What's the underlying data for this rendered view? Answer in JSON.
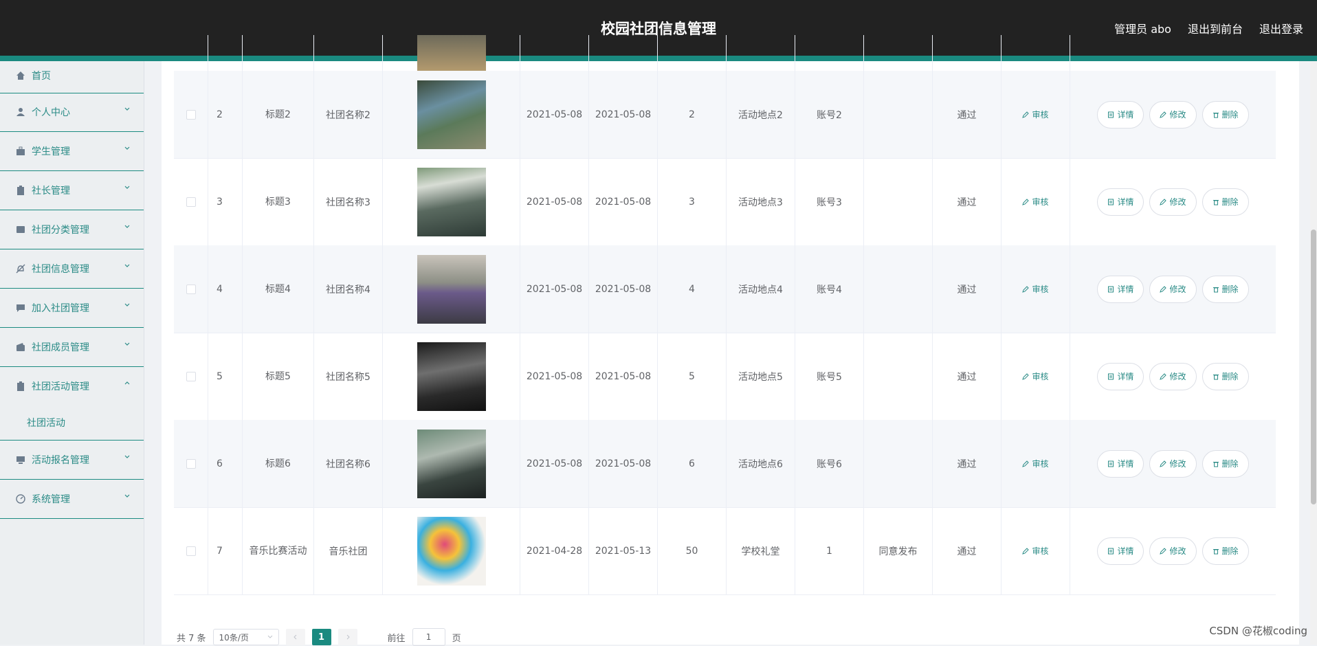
{
  "header": {
    "title": "校园社团信息管理",
    "admin": "管理员 abo",
    "to_front": "退出到前台",
    "logout": "退出登录"
  },
  "sidebar": {
    "items": [
      {
        "label": "首页",
        "icon": "home-icon"
      },
      {
        "label": "个人中心",
        "icon": "user-icon"
      },
      {
        "label": "学生管理",
        "icon": "briefcase-icon"
      },
      {
        "label": "社长管理",
        "icon": "clipboard-icon"
      },
      {
        "label": "社团分类管理",
        "icon": "book-icon"
      },
      {
        "label": "社团信息管理",
        "icon": "bell-off-icon"
      },
      {
        "label": "加入社团管理",
        "icon": "chat-icon"
      },
      {
        "label": "社团成员管理",
        "icon": "wallet-icon"
      },
      {
        "label": "社团活动管理",
        "icon": "clipboard-icon"
      },
      {
        "label": "活动报名管理",
        "icon": "monitor-icon"
      },
      {
        "label": "系统管理",
        "icon": "gauge-icon"
      }
    ],
    "sub_item": "社团活动"
  },
  "table": {
    "audit_label": "审核",
    "detail_label": "详情",
    "edit_label": "修改",
    "delete_label": "删除",
    "rows": [
      {
        "idx": "2",
        "title": "标题2",
        "club": "社团名称2",
        "start": "2021-05-08",
        "end": "2021-05-08",
        "count": "2",
        "place": "活动地点2",
        "account": "账号2",
        "reply": "",
        "status": "通过"
      },
      {
        "idx": "3",
        "title": "标题3",
        "club": "社团名称3",
        "start": "2021-05-08",
        "end": "2021-05-08",
        "count": "3",
        "place": "活动地点3",
        "account": "账号3",
        "reply": "",
        "status": "通过"
      },
      {
        "idx": "4",
        "title": "标题4",
        "club": "社团名称4",
        "start": "2021-05-08",
        "end": "2021-05-08",
        "count": "4",
        "place": "活动地点4",
        "account": "账号4",
        "reply": "",
        "status": "通过"
      },
      {
        "idx": "5",
        "title": "标题5",
        "club": "社团名称5",
        "start": "2021-05-08",
        "end": "2021-05-08",
        "count": "5",
        "place": "活动地点5",
        "account": "账号5",
        "reply": "",
        "status": "通过"
      },
      {
        "idx": "6",
        "title": "标题6",
        "club": "社团名称6",
        "start": "2021-05-08",
        "end": "2021-05-08",
        "count": "6",
        "place": "活动地点6",
        "account": "账号6",
        "reply": "",
        "status": "通过"
      },
      {
        "idx": "7",
        "title": "音乐比赛活动",
        "club": "音乐社团",
        "start": "2021-04-28",
        "end": "2021-05-13",
        "count": "50",
        "place": "学校礼堂",
        "account": "1",
        "reply": "同意发布",
        "status": "通过"
      }
    ]
  },
  "pagination": {
    "total": "共 7 条",
    "page_size": "10条/页",
    "current": "1",
    "goto_prefix": "前往",
    "goto_value": "1",
    "goto_suffix": "页"
  },
  "watermark": "CSDN @花椒coding",
  "colors": {
    "accent": "#1a8a80",
    "topbar": "#222222"
  }
}
